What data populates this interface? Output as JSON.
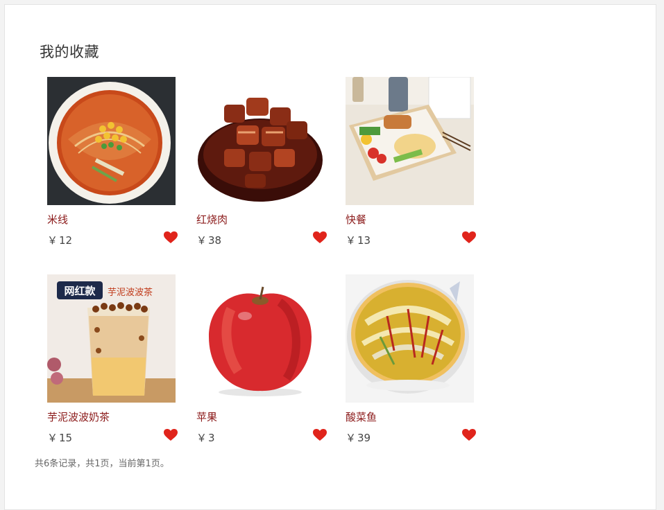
{
  "page": {
    "title": "我的收藏",
    "currency_symbol": "￥",
    "heart_color": "#e0241b",
    "name_color": "#8b1a1a"
  },
  "items": [
    {
      "name": "米线",
      "price": "12",
      "image": "rice-noodle-image"
    },
    {
      "name": "红烧肉",
      "price": "38",
      "image": "braised-pork-image"
    },
    {
      "name": "快餐",
      "price": "13",
      "image": "bento-box-image"
    },
    {
      "name": "芋泥波波奶茶",
      "price": "15",
      "image": "milk-tea-image"
    },
    {
      "name": "苹果",
      "price": "3",
      "image": "apple-image"
    },
    {
      "name": "酸菜鱼",
      "price": "39",
      "image": "pickled-fish-image"
    }
  ],
  "milk_tea_badge": {
    "tag": "网红款",
    "title": "芋泥波波茶"
  },
  "pagination": {
    "summary": "共6条记录，共1页，当前第1页。"
  }
}
